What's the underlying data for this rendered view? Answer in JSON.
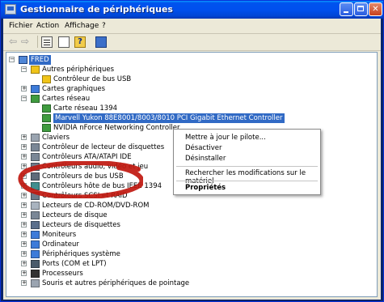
{
  "window": {
    "title": "Gestionnaire de périphériques"
  },
  "menu": [
    "Fichier",
    "Action",
    "Affichage",
    "?"
  ],
  "tree": {
    "root": "FRED",
    "rows": [
      {
        "label": "Autres périphériques",
        "icon": "unknown-devices-icon",
        "expander": "-"
      },
      {
        "label": "Contrôleur de bus USB",
        "icon": "unknown-device-icon"
      },
      {
        "label": "Cartes graphiques",
        "icon": "display-adapter-icon",
        "expander": "+"
      },
      {
        "label": "Cartes réseau",
        "icon": "network-adapter-icon",
        "expander": "-"
      },
      {
        "label": "Carte réseau 1394",
        "icon": "network-card-icon"
      },
      {
        "label": "Marvell Yukon 88E8001/8003/8010 PCI Gigabit Ethernet Controller",
        "icon": "network-card-icon",
        "selected": true
      },
      {
        "label": "NVIDIA nForce Networking Controller",
        "icon": "network-card-icon"
      },
      {
        "label": "Claviers",
        "icon": "keyboard-icon",
        "expander": "+"
      },
      {
        "label": "Contrôleur de lecteur de disquettes",
        "icon": "floppy-controller-icon",
        "expander": "+"
      },
      {
        "label": "Contrôleurs ATA/ATAPI IDE",
        "icon": "ide-controller-icon",
        "expander": "+"
      },
      {
        "label": "Contrôleurs audio, vidéo et jeu",
        "icon": "sound-icon",
        "expander": "+"
      },
      {
        "label": "Contrôleurs de bus USB",
        "icon": "usb-icon",
        "expander": "+"
      },
      {
        "label": "Contrôleurs hôte de bus IEEE 1394",
        "icon": "ieee1394-icon",
        "expander": "+"
      },
      {
        "label": "Contrôleurs SCSI et RAID",
        "icon": "scsi-icon",
        "expander": "+"
      },
      {
        "label": "Lecteurs de CD-ROM/DVD-ROM",
        "icon": "cdrom-icon",
        "expander": "+"
      },
      {
        "label": "Lecteurs de disque",
        "icon": "disk-drive-icon",
        "expander": "+"
      },
      {
        "label": "Lecteurs de disquettes",
        "icon": "floppy-icon",
        "expander": "+"
      },
      {
        "label": "Moniteurs",
        "icon": "monitor-icon",
        "expander": "+"
      },
      {
        "label": "Ordinateur",
        "icon": "computer-icon",
        "expander": "+"
      },
      {
        "label": "Périphériques système",
        "icon": "system-devices-icon",
        "expander": "+"
      },
      {
        "label": "Ports (COM et LPT)",
        "icon": "port-icon",
        "expander": "+"
      },
      {
        "label": "Processeurs",
        "icon": "processor-icon",
        "expander": "+"
      },
      {
        "label": "Souris et autres périphériques de pointage",
        "icon": "mouse-icon",
        "expander": "+"
      }
    ]
  },
  "context_menu": {
    "update_driver": "Mettre à jour le pilote...",
    "disable": "Désactiver",
    "uninstall": "Désinstaller",
    "scan_hardware": "Rechercher les modifications sur le matériel",
    "properties": "Propriétés"
  },
  "colors": {
    "selection": "#316ac5",
    "titlebar": "#0053ee",
    "annotation": "#c0180f"
  }
}
